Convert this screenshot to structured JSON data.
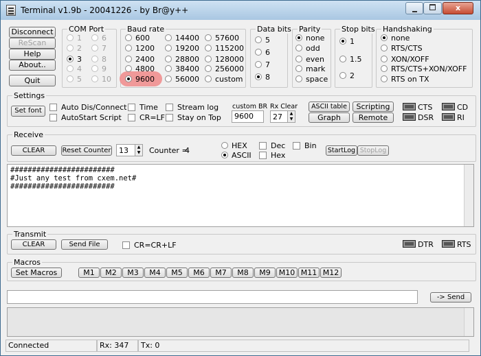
{
  "window": {
    "title": "Terminal v1.9b - 20041226 - by Br@y++",
    "close_label": "x"
  },
  "main_buttons": {
    "disconnect": "Disconnect",
    "rescan": "ReScan",
    "help": "Help",
    "about": "About..",
    "quit": "Quit"
  },
  "com_port": {
    "title": "COM Port",
    "col1": [
      "1",
      "2",
      "3",
      "4",
      "5"
    ],
    "col2": [
      "6",
      "7",
      "8",
      "9",
      "10"
    ],
    "selected": "3"
  },
  "baud_rate": {
    "title": "Baud rate",
    "col1": [
      "600",
      "1200",
      "2400",
      "4800",
      "9600"
    ],
    "col2": [
      "14400",
      "19200",
      "28800",
      "38400",
      "56000"
    ],
    "col3": [
      "57600",
      "115200",
      "128000",
      "256000",
      "custom"
    ],
    "selected": "9600",
    "highlight_color": "#f08a8a"
  },
  "data_bits": {
    "title": "Data bits",
    "options": [
      "5",
      "6",
      "7",
      "8"
    ],
    "selected": "8"
  },
  "parity": {
    "title": "Parity",
    "options": [
      "none",
      "odd",
      "even",
      "mark",
      "space"
    ],
    "selected": "none"
  },
  "stop_bits": {
    "title": "Stop bits",
    "options": [
      "1",
      "1.5",
      "2"
    ],
    "selected": "1"
  },
  "handshaking": {
    "title": "Handshaking",
    "options": [
      "none",
      "RTS/CTS",
      "XON/XOFF",
      "RTS/CTS+XON/XOFF",
      "RTS on TX"
    ],
    "selected": "none"
  },
  "settings": {
    "title": "Settings",
    "set_font": "Set font",
    "auto_dis_connect": "Auto Dis/Connect",
    "autostart_script": "AutoStart Script",
    "time": "Time",
    "cr_lf": "CR=LF",
    "stream_log": "Stream log",
    "stay_on_top": "Stay on Top",
    "custom_br_label": "custom BR",
    "custom_br_value": "9600",
    "rx_clear_label": "Rx Clear",
    "rx_clear_value": "27",
    "ascii_table": "ASCII table",
    "graph": "Graph",
    "scripting": "Scripting",
    "remote": "Remote",
    "cts": "CTS",
    "cd": "CD",
    "dsr": "DSR",
    "ri": "RI"
  },
  "receive": {
    "title": "Receive",
    "clear": "CLEAR",
    "reset_counter": "Reset Counter",
    "counter_spin": "13",
    "counter_label": "Counter =",
    "counter_value": "4",
    "hex": "HEX",
    "ascii": "ASCII",
    "dec": "Dec",
    "hex_check": "Hex",
    "bin": "Bin",
    "start_log": "StartLog",
    "stop_log": "StopLog",
    "format_selected": "ASCII",
    "lines": [
      "########################",
      "#Just any test from cxem.net#",
      "########################"
    ]
  },
  "transmit": {
    "title": "Transmit",
    "clear": "CLEAR",
    "send_file": "Send File",
    "cr_crlf": "CR=CR+LF",
    "dtr": "DTR",
    "rts": "RTS"
  },
  "macros": {
    "title": "Macros",
    "set_macros": "Set Macros",
    "buttons": [
      "M1",
      "M2",
      "M3",
      "M4",
      "M5",
      "M6",
      "M7",
      "M8",
      "M9",
      "M10",
      "M11",
      "M12"
    ]
  },
  "send": {
    "input_value": "",
    "send_label": "-> Send"
  },
  "status": {
    "connection": "Connected",
    "rx": "Rx: 347",
    "tx": "Tx: 0"
  }
}
